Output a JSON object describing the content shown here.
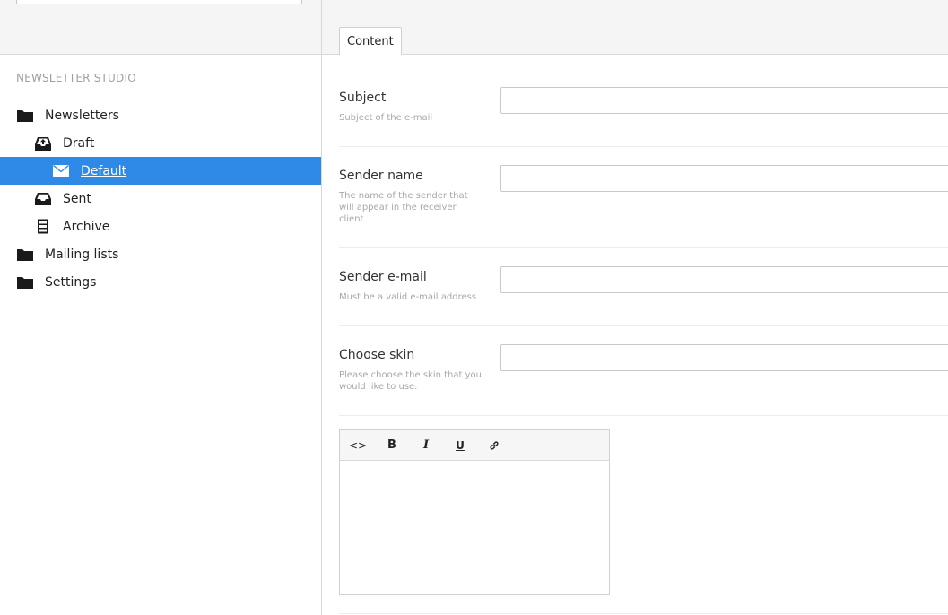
{
  "sidebar": {
    "section_title": "NEWSLETTER STUDIO",
    "items": [
      {
        "label": "Newsletters",
        "icon": "folder-icon"
      },
      {
        "label": "Draft",
        "icon": "inbox-upload-icon"
      },
      {
        "label": "Default",
        "icon": "envelope-icon",
        "selected": true
      },
      {
        "label": "Sent",
        "icon": "inbox-icon"
      },
      {
        "label": "Archive",
        "icon": "archive-box-icon"
      },
      {
        "label": "Mailing lists",
        "icon": "folder-icon"
      },
      {
        "label": "Settings",
        "icon": "folder-icon"
      }
    ]
  },
  "main": {
    "tabs": [
      {
        "label": "Content"
      }
    ],
    "fields": [
      {
        "label": "Subject",
        "description": "Subject of the e-mail",
        "value": ""
      },
      {
        "label": "Sender name",
        "description": "The name of the sender that will appear in the receiver client",
        "value": ""
      },
      {
        "label": "Sender e-mail",
        "description": "Must be a valid e-mail address",
        "value": ""
      },
      {
        "label": "Choose skin",
        "description": "Please choose the skin that you would like to use.",
        "value": ""
      }
    ],
    "editor": {
      "toolbar": [
        "code-icon",
        "bold-icon",
        "italic-icon",
        "underline-icon",
        "link-icon"
      ],
      "toolbar_labels": {
        "code": "<>",
        "bold": "B",
        "italic": "I",
        "underline": "U"
      },
      "content": ""
    }
  },
  "colors": {
    "selected": "#2e8ae6",
    "header_bg": "#f5f5f5"
  }
}
